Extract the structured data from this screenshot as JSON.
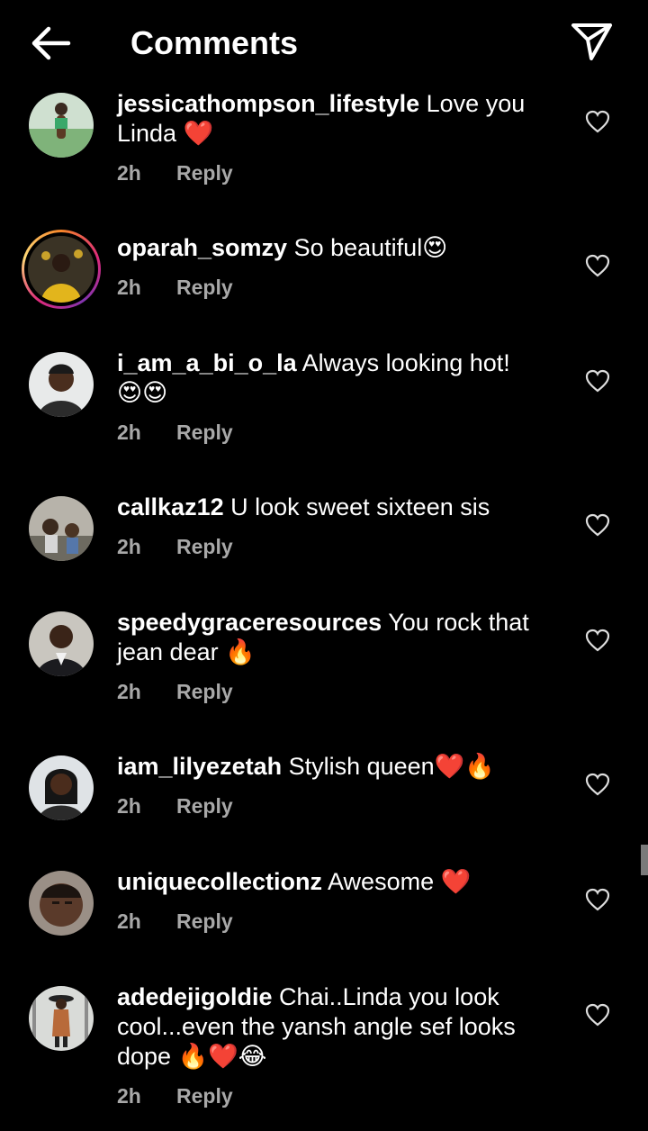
{
  "header": {
    "title": "Comments",
    "back_icon": "arrow-left-icon",
    "share_icon": "paper-plane-icon"
  },
  "colors": {
    "background": "#000000",
    "text": "#ffffff",
    "muted": "#a8a8a8"
  },
  "comments": [
    {
      "username": "jessicathompson_lifestyle",
      "text": " Love you Linda ❤️",
      "time": "2h",
      "reply_label": "Reply",
      "story_ring": false
    },
    {
      "username": "oparah_somzy",
      "text": " So beautiful😍",
      "time": "2h",
      "reply_label": "Reply",
      "story_ring": true
    },
    {
      "username": "i_am_a_bi_o_la",
      "text": " Always looking hot! 😍😍",
      "time": "2h",
      "reply_label": "Reply",
      "story_ring": false
    },
    {
      "username": "callkaz12",
      "text": " U look sweet sixteen sis",
      "time": "2h",
      "reply_label": "Reply",
      "story_ring": false
    },
    {
      "username": "speedygraceresources",
      "text": " You rock that jean dear 🔥",
      "time": "2h",
      "reply_label": "Reply",
      "story_ring": false
    },
    {
      "username": "iam_lilyezetah",
      "text": " Stylish queen❤️🔥",
      "time": "2h",
      "reply_label": "Reply",
      "story_ring": false
    },
    {
      "username": "uniquecollectionz",
      "text": " Awesome ❤️",
      "time": "2h",
      "reply_label": "Reply",
      "story_ring": false
    },
    {
      "username": "adedejigoldie",
      "text": " Chai..Linda you look cool...even the yansh angle sef looks dope 🔥❤️😂",
      "time": "2h",
      "reply_label": "Reply",
      "story_ring": false
    }
  ]
}
